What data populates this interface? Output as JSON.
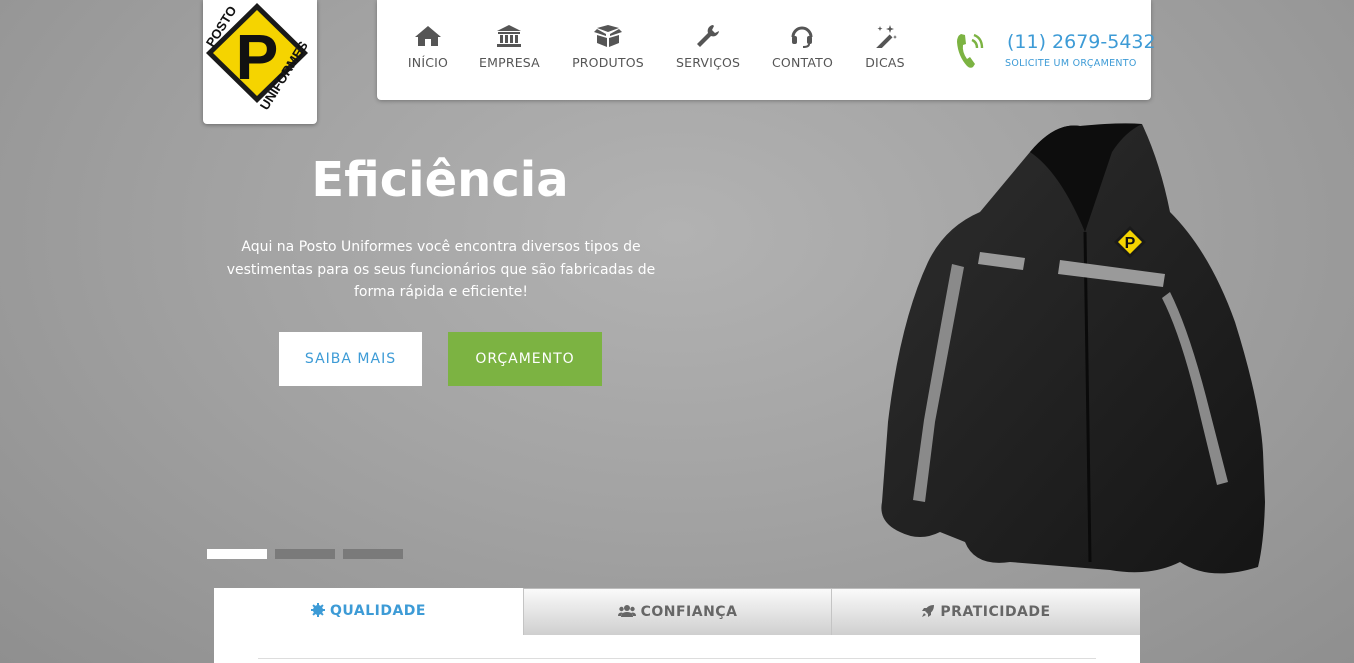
{
  "logo": {
    "top_text": "POSTO",
    "letter": "P",
    "bottom_text": "UNIFORMES"
  },
  "nav": {
    "items": [
      {
        "label": "INÍCIO",
        "icon": "home-icon"
      },
      {
        "label": "EMPRESA",
        "icon": "bank-icon"
      },
      {
        "label": "PRODUTOS",
        "icon": "box-icon"
      },
      {
        "label": "SERVIÇOS",
        "icon": "wrench-icon"
      },
      {
        "label": "CONTATO",
        "icon": "headset-icon"
      },
      {
        "label": "DICAS",
        "icon": "magic-wand-icon"
      }
    ],
    "phone": "(11) 2679-5432",
    "phone_sub": "SOLICITE UM ORÇAMENTO"
  },
  "hero": {
    "title": "Eficiência",
    "text": "Aqui na Posto Uniformes você encontra diversos tipos de vestimentas para os seus funcionários que são fabricadas de forma rápida e eficiente!",
    "primary_button": "SAIBA MAIS",
    "secondary_button": "ORÇAMENTO",
    "slides_count": 3,
    "active_slide": 1
  },
  "tabs": [
    {
      "label": "QUALIDADE",
      "icon": "cog-icon",
      "active": true
    },
    {
      "label": "CONFIANÇA",
      "icon": "users-icon",
      "active": false
    },
    {
      "label": "PRATICIDADE",
      "icon": "rocket-icon",
      "active": false
    }
  ],
  "colors": {
    "accent_blue": "#3d9bd6",
    "accent_green": "#7cb342",
    "logo_yellow": "#f5d400"
  }
}
